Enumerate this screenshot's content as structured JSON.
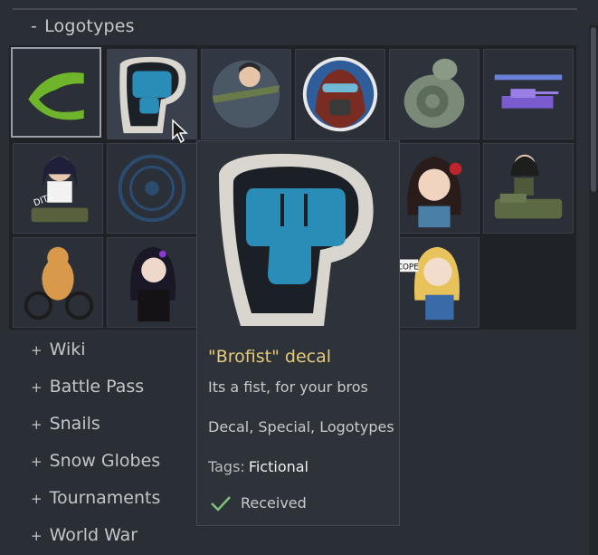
{
  "section": {
    "toggle_sign": "-",
    "title": "Logotypes"
  },
  "decals": [
    {
      "name": "nvidia-logo-decal"
    },
    {
      "name": "brofist-decal"
    },
    {
      "name": "pilot-girl-plane-decal"
    },
    {
      "name": "masked-pilot-portrait-decal"
    },
    {
      "name": "snail-decal"
    },
    {
      "name": "retro-tank-decal"
    },
    {
      "name": "dita-anime-girl-decal"
    },
    {
      "name": "round-emblem-decal"
    },
    {
      "name": "anime-girl-rose-decal"
    },
    {
      "name": "anime-girl-on-tank-decal"
    },
    {
      "name": "otter-bicycle-decal"
    },
    {
      "name": "dark-anime-girl-decal"
    },
    {
      "name": "cope-anime-girl-decal"
    }
  ],
  "cope_sign_text": "COPE",
  "dita_text": "DITA",
  "tooltip": {
    "title": "\"Brofist\" decal",
    "description": "Its a fist, for your bros",
    "categories": "Decal, Special, Logotypes",
    "tags_label": "Tags:",
    "tags_value": "Fictional",
    "status": "Received"
  },
  "menu": [
    {
      "sign": "+",
      "label": "Wiki"
    },
    {
      "sign": "+",
      "label": "Battle Pass"
    },
    {
      "sign": "+",
      "label": "Snails"
    },
    {
      "sign": "+",
      "label": "Snow Globes"
    },
    {
      "sign": "+",
      "label": "Tournaments"
    },
    {
      "sign": "+",
      "label": "World War"
    }
  ],
  "colors": {
    "accent_title": "#e6c97a",
    "brofist_blue": "#2a8db8",
    "check_green": "#7fc27a"
  }
}
